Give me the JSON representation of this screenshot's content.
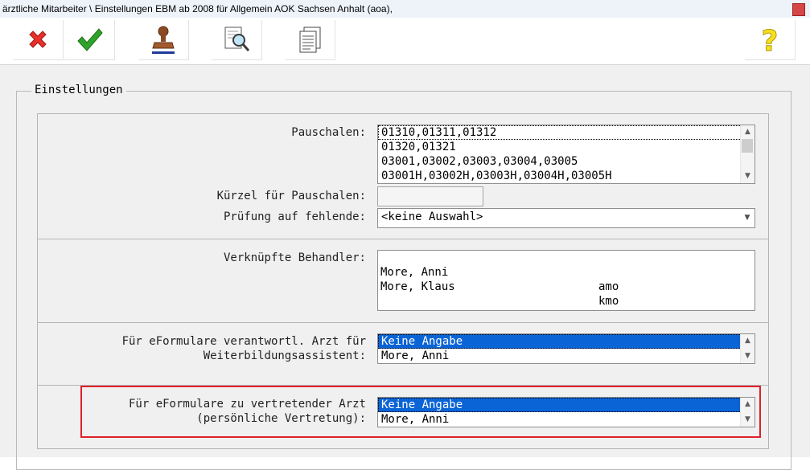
{
  "window": {
    "title": "ärztliche Mitarbeiter \\ Einstellungen EBM ab 2008 für Allgemein AOK Sachsen Anhalt (aoa),"
  },
  "toolbar": {
    "buttons": [
      {
        "icon": "red-x-icon"
      },
      {
        "icon": "green-check-icon"
      },
      {
        "icon": "stamp-icon"
      },
      {
        "icon": "magnifier-document-icon"
      },
      {
        "icon": "documents-icon"
      },
      {
        "icon": "help-question-icon"
      }
    ]
  },
  "group": {
    "title": "Einstellungen"
  },
  "pauschalen": {
    "label": "Pauschalen:",
    "items": [
      "01310,01311,01312",
      "01320,01321",
      "03001,03002,03003,03004,03005",
      "03001H,03002H,03003H,03004H,03005H"
    ]
  },
  "kuerzel": {
    "label": "Kürzel für Pauschalen:",
    "value": ""
  },
  "pruefung": {
    "label": "Prüfung auf fehlende:",
    "value": "<keine Auswahl>"
  },
  "behandler": {
    "label": "Verknüpfte Behandler:",
    "rows": [
      {
        "name": "More, Anni",
        "code": "amo"
      },
      {
        "name": "More, Klaus",
        "code": "kmo"
      }
    ]
  },
  "weiterbildung": {
    "label_line1": "Für eFormulare verantwortl. Arzt für",
    "label_line2": "Weiterbildungsassistent:",
    "items": [
      "Keine Angabe",
      "More, Anni"
    ]
  },
  "vertretung": {
    "label_line1": "Für eFormulare zu vertretender Arzt",
    "label_line2": "(persönliche Vertretung):",
    "items": [
      "Keine Angabe",
      "More, Anni"
    ]
  },
  "colors": {
    "selection": "#0a64d6",
    "highlight_border": "#e0202a",
    "background": "#f0f0f0"
  }
}
